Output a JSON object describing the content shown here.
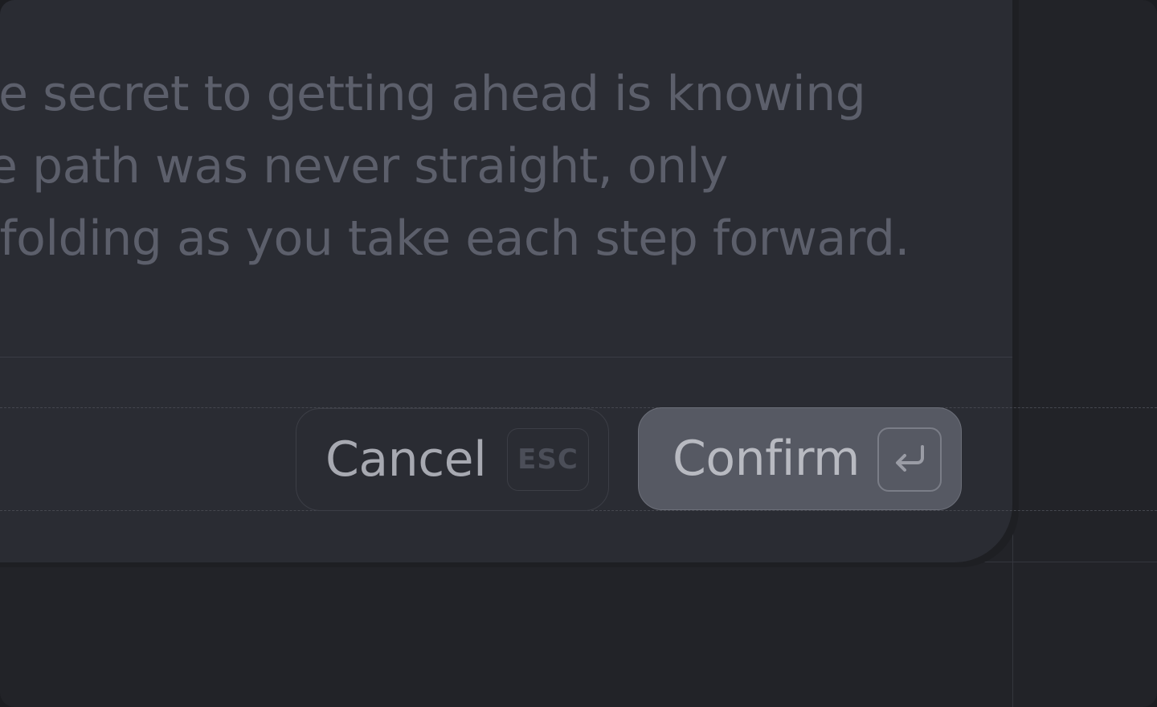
{
  "dialog": {
    "message_lines": [
      "The secret to getting ahead is knowing",
      "the path was never straight, only",
      "unfolding as you take each step forward."
    ],
    "cancel": {
      "label": "Cancel",
      "shortcut": "ESC"
    },
    "confirm": {
      "label": "Confirm",
      "shortcut_icon": "enter-return-icon"
    }
  },
  "colors": {
    "background": "#222328",
    "dialog_surface": "#2a2c33",
    "message_text": "#5c5f6b",
    "confirm_fill": "#565963"
  }
}
